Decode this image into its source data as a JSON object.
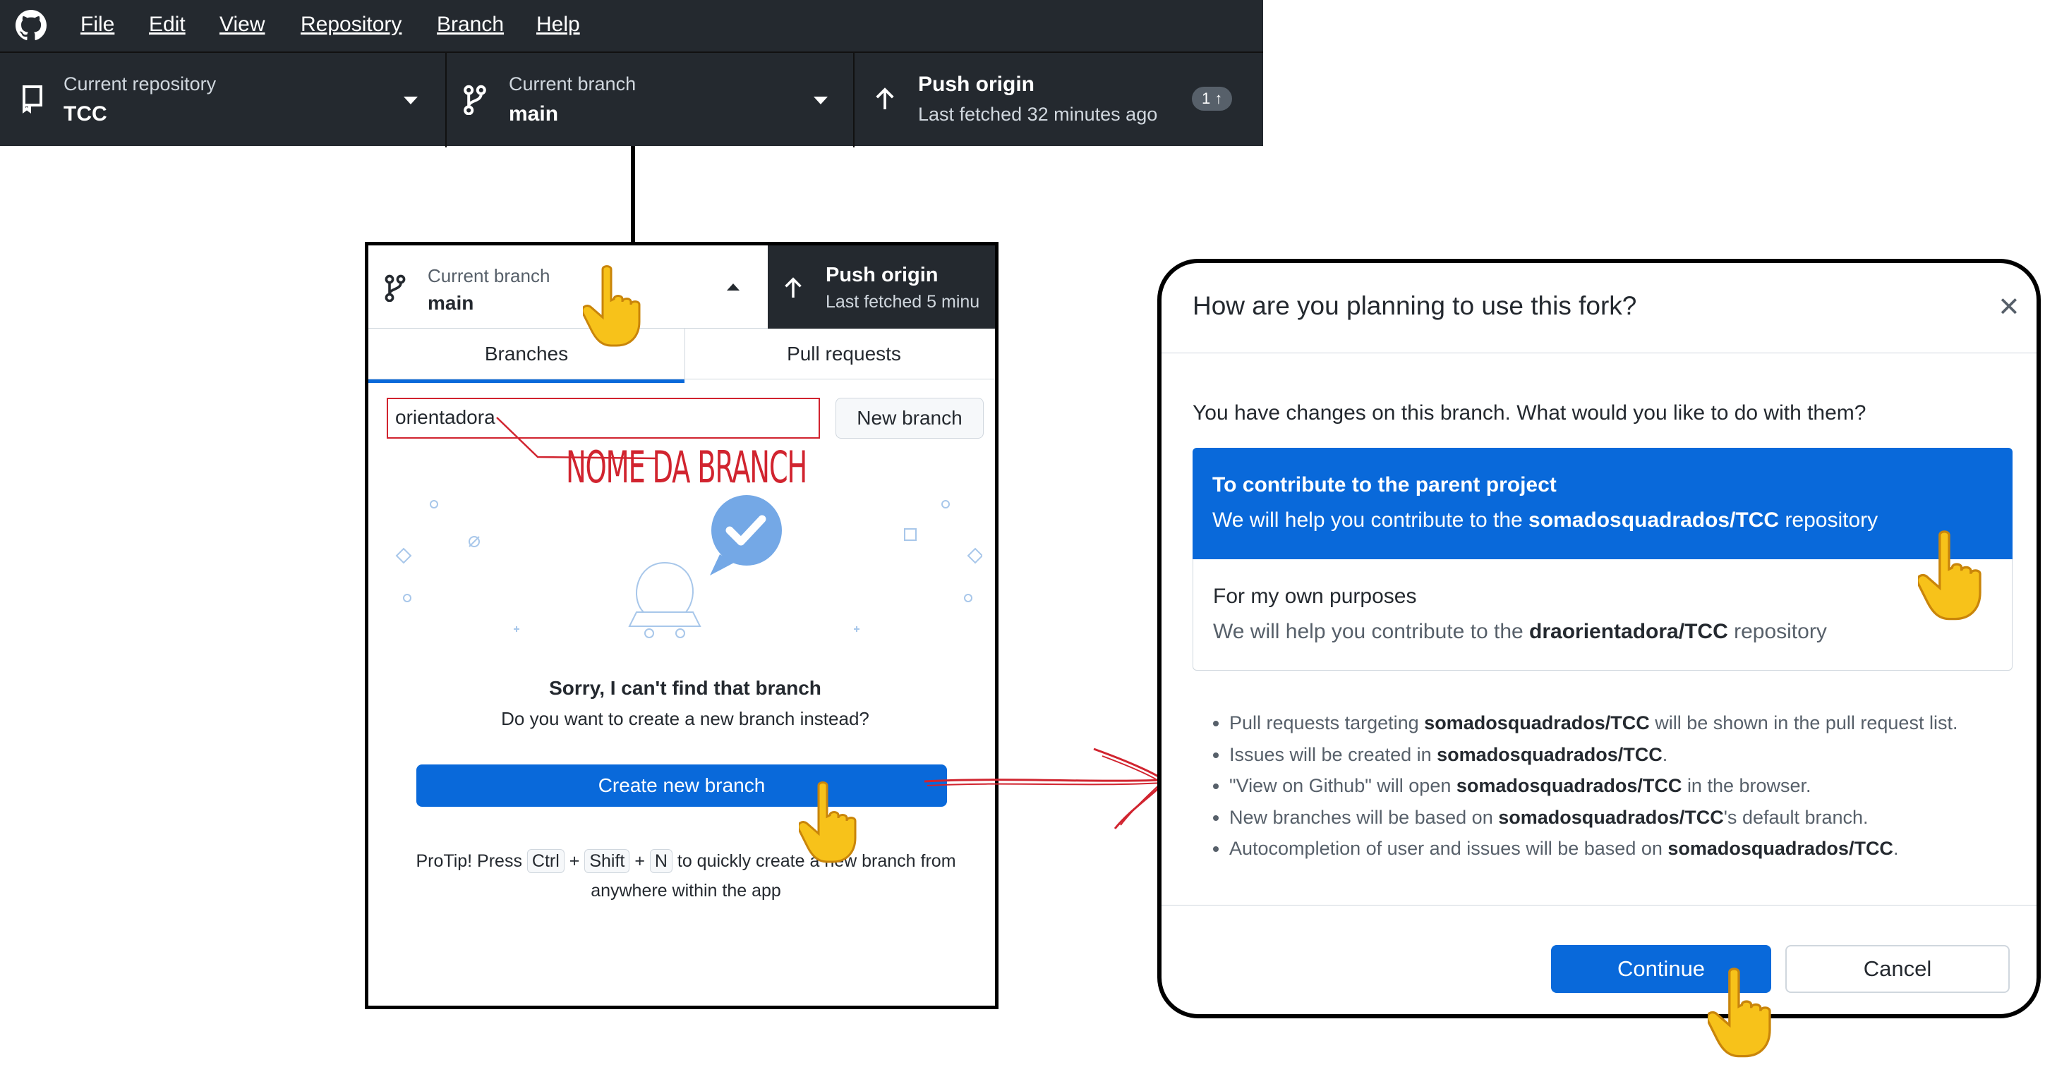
{
  "menu": {
    "file": "File",
    "edit": "Edit",
    "view": "View",
    "repository": "Repository",
    "branch": "Branch",
    "help": "Help"
  },
  "toolbar": {
    "repo_label": "Current repository",
    "repo_value": "TCC",
    "branch_label": "Current branch",
    "branch_value": "main",
    "push_title": "Push origin",
    "push_sub": "Last fetched 32 minutes ago",
    "push_badge": "1 ↑"
  },
  "branch_panel": {
    "branch_label": "Current branch",
    "branch_value": "main",
    "push_title": "Push origin",
    "push_sub": "Last fetched 5 minu",
    "tab_branches": "Branches",
    "tab_pull_requests": "Pull requests",
    "filter_value": "orientadora",
    "new_branch_button": "New branch",
    "annotation": "NOME DA BRANCH",
    "sorry_title": "Sorry, I can't find that branch",
    "sorry_sub": "Do you want to create a new branch instead?",
    "create_button": "Create new branch",
    "protip_prefix": "ProTip! Press",
    "key_ctrl": "Ctrl",
    "key_shift": "Shift",
    "key_n": "N",
    "plus": "+",
    "protip_suffix": "to quickly create a new branch from anywhere within the app"
  },
  "dialog": {
    "title": "How are you planning to use this fork?",
    "close_icon": "✕",
    "question": "You have changes on this branch. What would you like to do with them?",
    "option1_title": "To contribute to the parent project",
    "option1_desc_prefix": "We will help you contribute to the",
    "option1_repo": "somadosquadrados/TCC",
    "option1_desc_suffix": "repository",
    "option2_title": "For my own purposes",
    "option2_desc_prefix": "We will help you contribute to the",
    "option2_repo": "draorientadora/TCC",
    "option2_desc_suffix": "repository",
    "bullets": [
      {
        "pre": "Pull requests targeting",
        "bold": "somadosquadrados/TCC",
        "post": "will be shown in the pull request list."
      },
      {
        "pre": "Issues will be created in",
        "bold": "somadosquadrados/TCC",
        "post": "."
      },
      {
        "pre": "\"View on Github\" will open",
        "bold": "somadosquadrados/TCC",
        "post": "in the browser."
      },
      {
        "pre": "New branches will be based on",
        "bold": "somadosquadrados/TCC",
        "post": "'s default branch."
      },
      {
        "pre": "Autocompletion of user and issues will be based on",
        "bold": "somadosquadrados/TCC",
        "post": "."
      }
    ],
    "continue_button": "Continue",
    "cancel_button": "Cancel"
  },
  "colors": {
    "accent": "#0969da",
    "dark_bar": "#24292f",
    "annotation": "#d1242f",
    "hand": "#f7c21a"
  }
}
